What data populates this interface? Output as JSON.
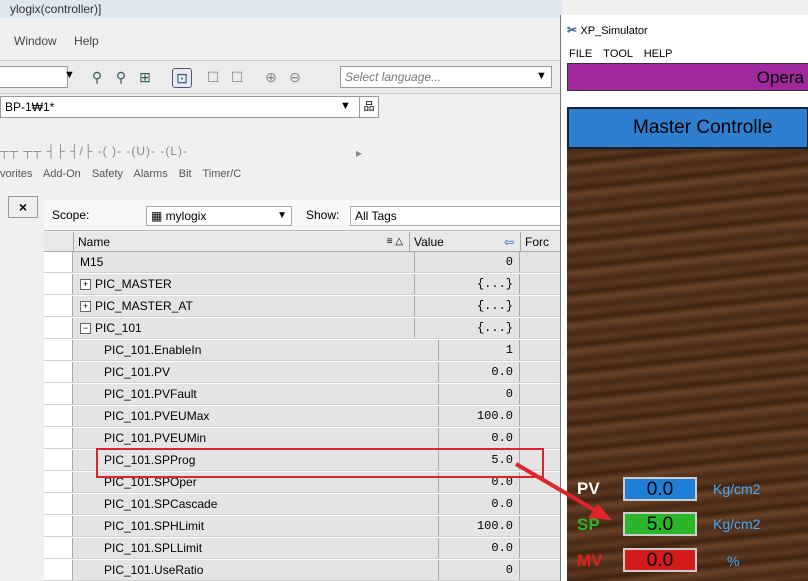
{
  "left_app": {
    "title": "ylogix(controller)]",
    "menu": [
      "Window",
      "Help"
    ],
    "language_placeholder": "Select language...",
    "path_combo": "BP-1₩1*",
    "ladder_glyphs": "┬┬  ┬┬   ┤├  ┤/├  -( )-  -(U)-  -(L)-",
    "tabs": [
      "vorites",
      "Add-On",
      "Safety",
      "Alarms",
      "Bit",
      "Timer/C"
    ],
    "close_label": "×",
    "scope_label": "Scope:",
    "scope_value": "mylogix",
    "show_label": "Show:",
    "show_value": "All Tags",
    "columns": {
      "name": "Name",
      "value": "Value",
      "force": "Forc"
    },
    "rows": [
      {
        "name": "M15",
        "value": "0",
        "expander": "",
        "indent": 0
      },
      {
        "name": "PIC_MASTER",
        "value": "{...}",
        "expander": "+",
        "indent": 0
      },
      {
        "name": "PIC_MASTER_AT",
        "value": "{...}",
        "expander": "+",
        "indent": 0
      },
      {
        "name": "PIC_101",
        "value": "{...}",
        "expander": "−",
        "indent": 0
      },
      {
        "name": "PIC_101.EnableIn",
        "value": "1",
        "expander": "",
        "indent": 1
      },
      {
        "name": "PIC_101.PV",
        "value": "0.0",
        "expander": "",
        "indent": 1
      },
      {
        "name": "PIC_101.PVFault",
        "value": "0",
        "expander": "",
        "indent": 1
      },
      {
        "name": "PIC_101.PVEUMax",
        "value": "100.0",
        "expander": "",
        "indent": 1
      },
      {
        "name": "PIC_101.PVEUMin",
        "value": "0.0",
        "expander": "",
        "indent": 1
      },
      {
        "name": "PIC_101.SPProg",
        "value": "5.0",
        "expander": "",
        "indent": 1
      },
      {
        "name": "PIC_101.SPOper",
        "value": "0.0",
        "expander": "",
        "indent": 1
      },
      {
        "name": "PIC_101.SPCascade",
        "value": "0.0",
        "expander": "",
        "indent": 1
      },
      {
        "name": "PIC_101.SPHLimit",
        "value": "100.0",
        "expander": "",
        "indent": 1
      },
      {
        "name": "PIC_101.SPLLimit",
        "value": "0.0",
        "expander": "",
        "indent": 1
      },
      {
        "name": "PIC_101.UseRatio",
        "value": "0",
        "expander": "",
        "indent": 1
      }
    ]
  },
  "simulator": {
    "title": "XP_Simulator",
    "menu": [
      "FILE",
      "TOOL",
      "HELP"
    ],
    "banner": "Opera",
    "header": "Master Controlle",
    "pv": {
      "label": "PV",
      "value": "0.0",
      "unit": "Kg/cm2",
      "color": "#1e7fd6"
    },
    "sp": {
      "label": "SP",
      "value": "5.0",
      "unit": "Kg/cm2",
      "color": "#2bb52b"
    },
    "mv": {
      "label": "MV",
      "value": "0.0",
      "unit": "%",
      "color": "#d31c1c"
    }
  },
  "colors": {
    "highlight": "#e0242c",
    "arrow": "#e0242c",
    "banner": "#a0289c",
    "header": "#2f7fd0"
  }
}
